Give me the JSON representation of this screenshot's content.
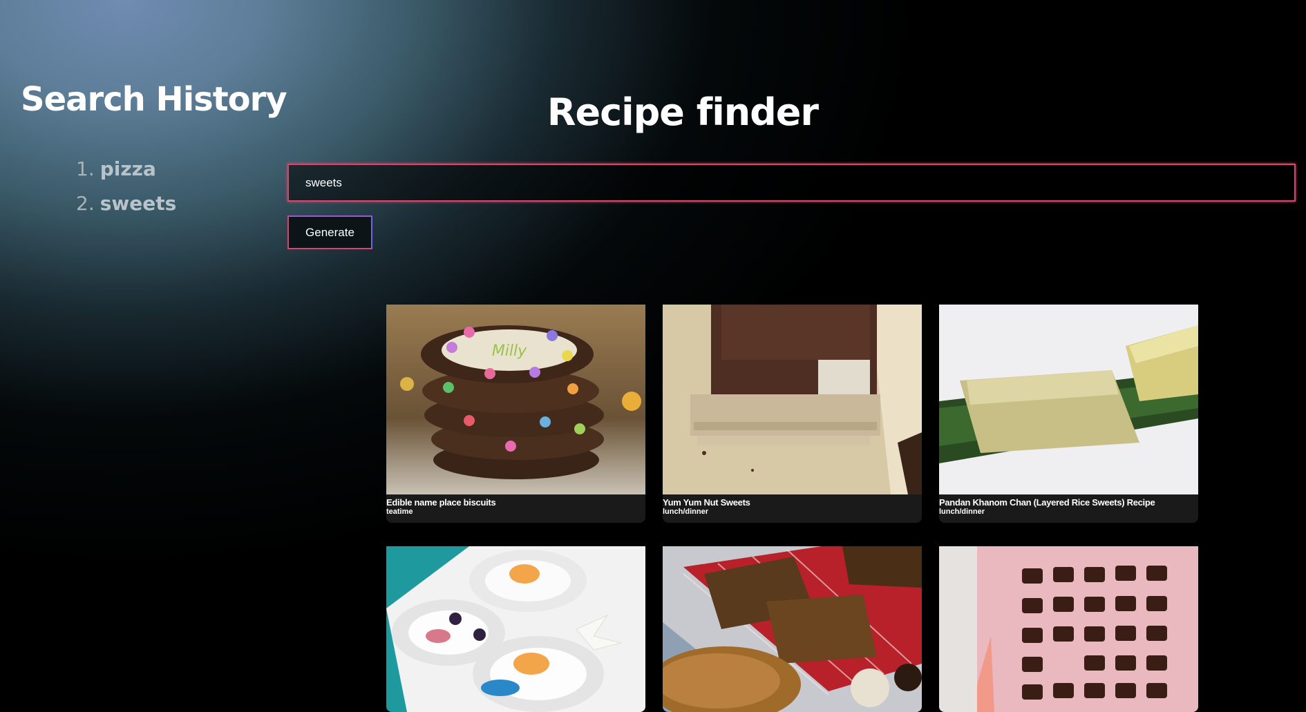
{
  "sidebar": {
    "title": "Search History",
    "items": [
      {
        "num": "1.",
        "label": "pizza"
      },
      {
        "num": "2.",
        "label": "sweets"
      }
    ]
  },
  "main": {
    "title": "Recipe finder",
    "search": {
      "value": "sweets"
    },
    "generate_label": "Generate"
  },
  "recipes": [
    {
      "title": "Edible name place biscuits",
      "meal": "teatime",
      "image": "stacked-candy-cookies-photo"
    },
    {
      "title": "Yum Yum Nut Sweets",
      "meal": "lunch/dinner",
      "image": "chocolate-brownie-slab-photo"
    },
    {
      "title": "Pandan Khanom Chan (Layered Rice Sweets) Recipe",
      "meal": "lunch/dinner",
      "image": "rice-sweets-on-leaf-photo"
    },
    {
      "title": "",
      "meal": "",
      "image": "yogurt-fruit-bowls-photo"
    },
    {
      "title": "",
      "meal": "",
      "image": "toffee-nut-bars-photo"
    },
    {
      "title": "",
      "meal": "",
      "image": "chocolate-squares-on-pink-photo"
    }
  ],
  "colors": {
    "accent_border": "#d6476c",
    "card_bg": "#1a1a1a"
  }
}
